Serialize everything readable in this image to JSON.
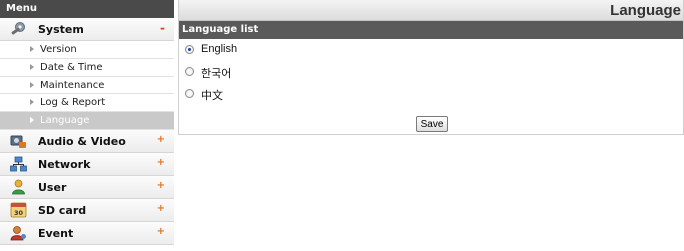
{
  "menu": {
    "header": "Menu",
    "sections": [
      {
        "label": "System",
        "sign": "-",
        "icon": "wrench-gear-icon"
      },
      {
        "label": "Audio & Video",
        "sign": "+",
        "icon": "camera-icon"
      },
      {
        "label": "Network",
        "sign": "+",
        "icon": "network-icon"
      },
      {
        "label": "User",
        "sign": "+",
        "icon": "user-icon"
      },
      {
        "label": "SD card",
        "sign": "+",
        "icon": "sd-card-icon"
      },
      {
        "label": "Event",
        "sign": "+",
        "icon": "event-icon"
      }
    ],
    "system_items": [
      {
        "label": "Version"
      },
      {
        "label": "Date & Time"
      },
      {
        "label": "Maintenance"
      },
      {
        "label": "Log & Report"
      },
      {
        "label": "Language",
        "active": true
      }
    ],
    "sd_icon_text": "30"
  },
  "page": {
    "title": "Language",
    "list_header": "Language list",
    "options": [
      {
        "label": "English",
        "checked": true
      },
      {
        "label": "한국어",
        "checked": false
      },
      {
        "label": "中文",
        "checked": false
      }
    ],
    "save_label": "Save"
  },
  "colors": {
    "minus_sign": "#e23d10",
    "plus_sign": "#e8731c",
    "radio_selected": "#1b3f9a",
    "header_bg": "#4a4a4a"
  }
}
